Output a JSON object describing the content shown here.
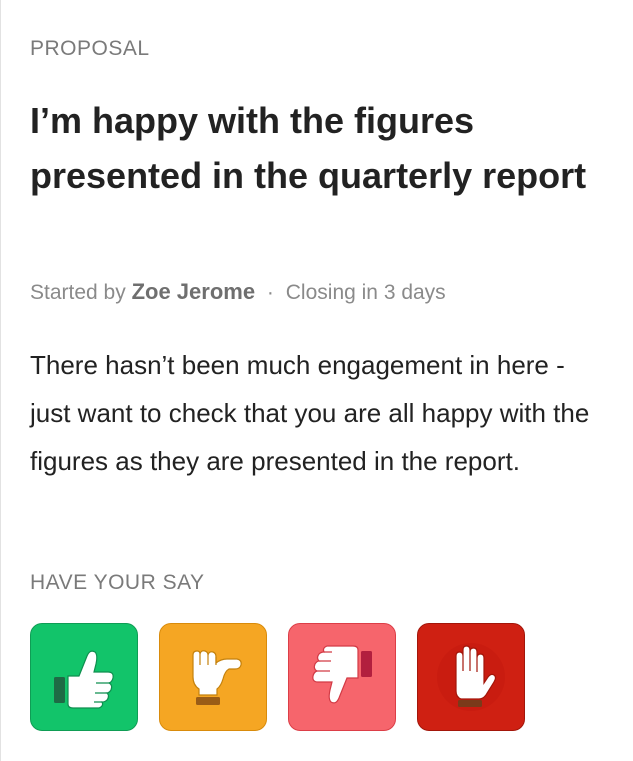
{
  "proposal": {
    "eyebrow": "PROPOSAL",
    "title": "I’m happy with the figures presented in the quarterly report",
    "meta": {
      "started_by_prefix": "Started by",
      "author": "Zoe Jerome",
      "separator": "·",
      "closing": "Closing in 3 days"
    },
    "description": "There hasn’t been much engagement in here - just want to check that you are all happy with the figures as they are presented in the report."
  },
  "have_your_say": {
    "label": "HAVE YOUR SAY",
    "options": [
      {
        "icon": "thumbs-up-icon",
        "color": "#12c46a"
      },
      {
        "icon": "thumbs-sideways-icon",
        "color": "#f5a623"
      },
      {
        "icon": "thumbs-down-icon",
        "color": "#f6656c"
      },
      {
        "icon": "raised-hand-block-icon",
        "color": "#cf2012"
      }
    ]
  }
}
